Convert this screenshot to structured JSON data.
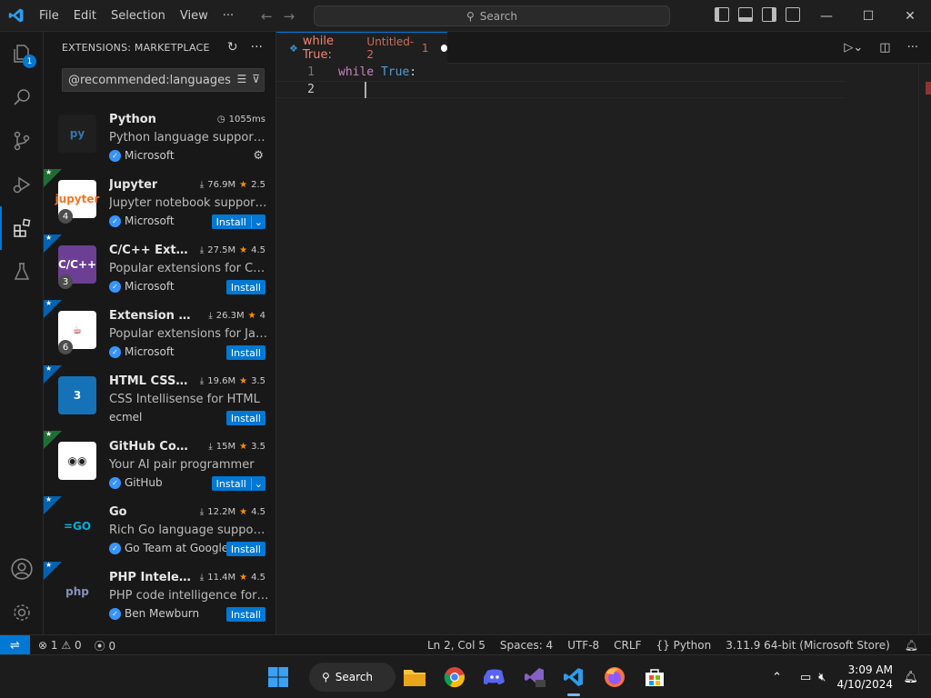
{
  "titlebar": {
    "menu": [
      "File",
      "Edit",
      "Selection",
      "View",
      "···"
    ],
    "search_label": "Search"
  },
  "activity": {
    "explorer_badge": "1"
  },
  "sidebar": {
    "title": "EXTENSIONS: MARKETPLACE",
    "search_value": "@recommended:languages",
    "extensions": [
      {
        "name": "Python",
        "stats": "1055ms",
        "stars": "",
        "desc": "Python language support with...",
        "publisher": "Microsoft",
        "action": "",
        "count": "",
        "icon_text": "py",
        "icon_bg": "#1f1f1f",
        "icon_color": "#3776ab"
      },
      {
        "name": "Jupyter",
        "stats": "76.9M",
        "stars": "2.5",
        "desc": "Jupyter notebook support, int...",
        "publisher": "Microsoft",
        "action": "Install",
        "count": "4",
        "icon_text": "jupyter",
        "icon_bg": "#ffffff",
        "icon_color": "#f37626"
      },
      {
        "name": "C/C++ Exte...",
        "stats": "27.5M",
        "stars": "4.5",
        "desc": "Popular extensions for C++ ...",
        "publisher": "Microsoft",
        "action": "Install",
        "count": "3",
        "icon_text": "C/C++",
        "icon_bg": "#6d3f94",
        "icon_color": "#ffffff"
      },
      {
        "name": "Extension Pa...",
        "stats": "26.3M",
        "stars": "4",
        "desc": "Popular extensions for Java ...",
        "publisher": "Microsoft",
        "action": "Install",
        "count": "6",
        "icon_text": "☕",
        "icon_bg": "#ffffff",
        "icon_color": "#b0231e"
      },
      {
        "name": "HTML CSS S...",
        "stats": "19.6M",
        "stars": "3.5",
        "desc": "CSS Intellisense for HTML",
        "publisher": "ecmel",
        "action": "Install",
        "count": "",
        "icon_text": "3",
        "icon_bg": "#1572b6",
        "icon_color": "#ffffff"
      },
      {
        "name": "GitHub Copilot",
        "stats": "15M",
        "stars": "3.5",
        "desc": "Your AI pair programmer",
        "publisher": "GitHub",
        "action": "Install",
        "count": "",
        "icon_text": "◉◉",
        "icon_bg": "#ffffff",
        "icon_color": "#1f1f1f"
      },
      {
        "name": "Go",
        "stats": "12.2M",
        "stars": "4.5",
        "desc": "Rich Go language support f...",
        "publisher": "Go Team at Google",
        "action": "Install",
        "count": "",
        "icon_text": "=GO",
        "icon_bg": "#181818",
        "icon_color": "#00add8"
      },
      {
        "name": "PHP Intelep...",
        "stats": "11.4M",
        "stars": "4.5",
        "desc": "PHP code intelligence for Vi...",
        "publisher": "Ben Mewburn",
        "action": "Install",
        "count": "",
        "icon_text": "php",
        "icon_bg": "#181818",
        "icon_color": "#8892bf"
      }
    ]
  },
  "editor": {
    "tab_title": "while True:",
    "tab_sub": "Untitled-2",
    "tab_problems": "1",
    "lines": [
      {
        "num": "1",
        "kw": "while",
        "const": "True",
        "rest": ":"
      },
      {
        "num": "2",
        "kw": "",
        "const": "",
        "rest": ""
      }
    ]
  },
  "statusbar": {
    "errors": "1",
    "warnings": "0",
    "ports": "0",
    "position": "Ln 2, Col 5",
    "spaces": "Spaces: 4",
    "encoding": "UTF-8",
    "eol": "CRLF",
    "language": "Python",
    "interpreter": "3.11.9 64-bit (Microsoft Store)"
  },
  "taskbar": {
    "search_label": "Search",
    "time": "3:09 AM",
    "date": "4/10/2024"
  }
}
